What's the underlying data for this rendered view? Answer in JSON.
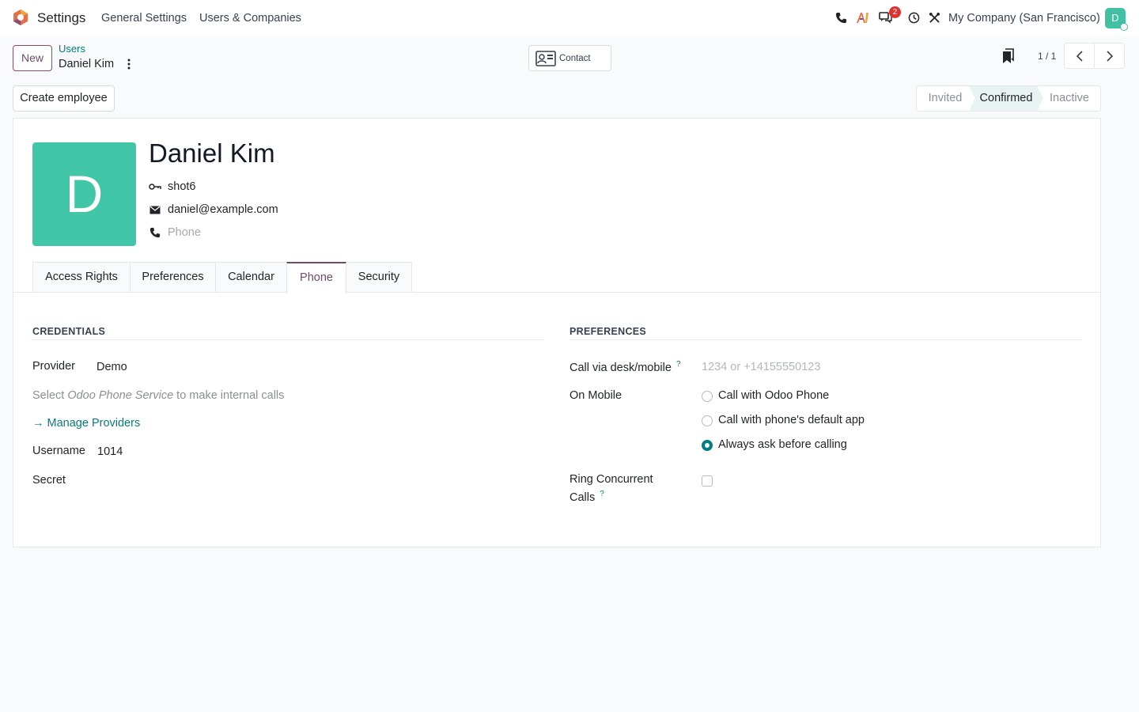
{
  "navbar": {
    "app_name": "Settings",
    "menu": [
      "General Settings",
      "Users & Companies"
    ],
    "messages_badge": "2",
    "company": "My Company (San Francisco)",
    "user_initial": "D"
  },
  "control_panel": {
    "new_label": "New",
    "breadcrumb_parent": "Users",
    "breadcrumb_current": "Daniel Kim",
    "contact_label": "Contact",
    "pager_value": "1 / 1"
  },
  "actions": {
    "create_employee_label": "Create employee"
  },
  "statusbar": {
    "steps": [
      "Invited",
      "Confirmed",
      "Inactive"
    ],
    "active": "Confirmed"
  },
  "user": {
    "initial": "D",
    "name": "Daniel Kim",
    "login": "shot6",
    "email": "daniel@example.com",
    "phone_placeholder": "Phone"
  },
  "tabs": [
    "Access Rights",
    "Preferences",
    "Calendar",
    "Phone",
    "Security"
  ],
  "active_tab": "Phone",
  "credentials": {
    "title": "CREDENTIALS",
    "provider_label": "Provider",
    "provider_value": "Demo",
    "hint_prefix": "Select ",
    "hint_italic": "Odoo Phone Service",
    "hint_suffix": " to make internal calls",
    "manage_providers": "→ Manage Providers",
    "username_label": "Username",
    "username_value": "1014",
    "secret_label": "Secret"
  },
  "preferences": {
    "title": "PREFERENCES",
    "call_via_label": "Call via desk/mobile",
    "call_via_placeholder": "1234 or +14155550123",
    "help_mark": "?",
    "on_mobile_label": "On Mobile",
    "mobile_options": [
      "Call with Odoo Phone",
      "Call with phone's default app",
      "Always ask before calling"
    ],
    "mobile_selected": "Always ask before calling",
    "ring_label_line1": "Ring Concurrent",
    "ring_label_line2": "Calls",
    "ring_checked": false
  },
  "colors": {
    "brand": "#714b67",
    "accent": "#017e84",
    "avatar": "#41c7a8",
    "badge": "#e03131"
  }
}
